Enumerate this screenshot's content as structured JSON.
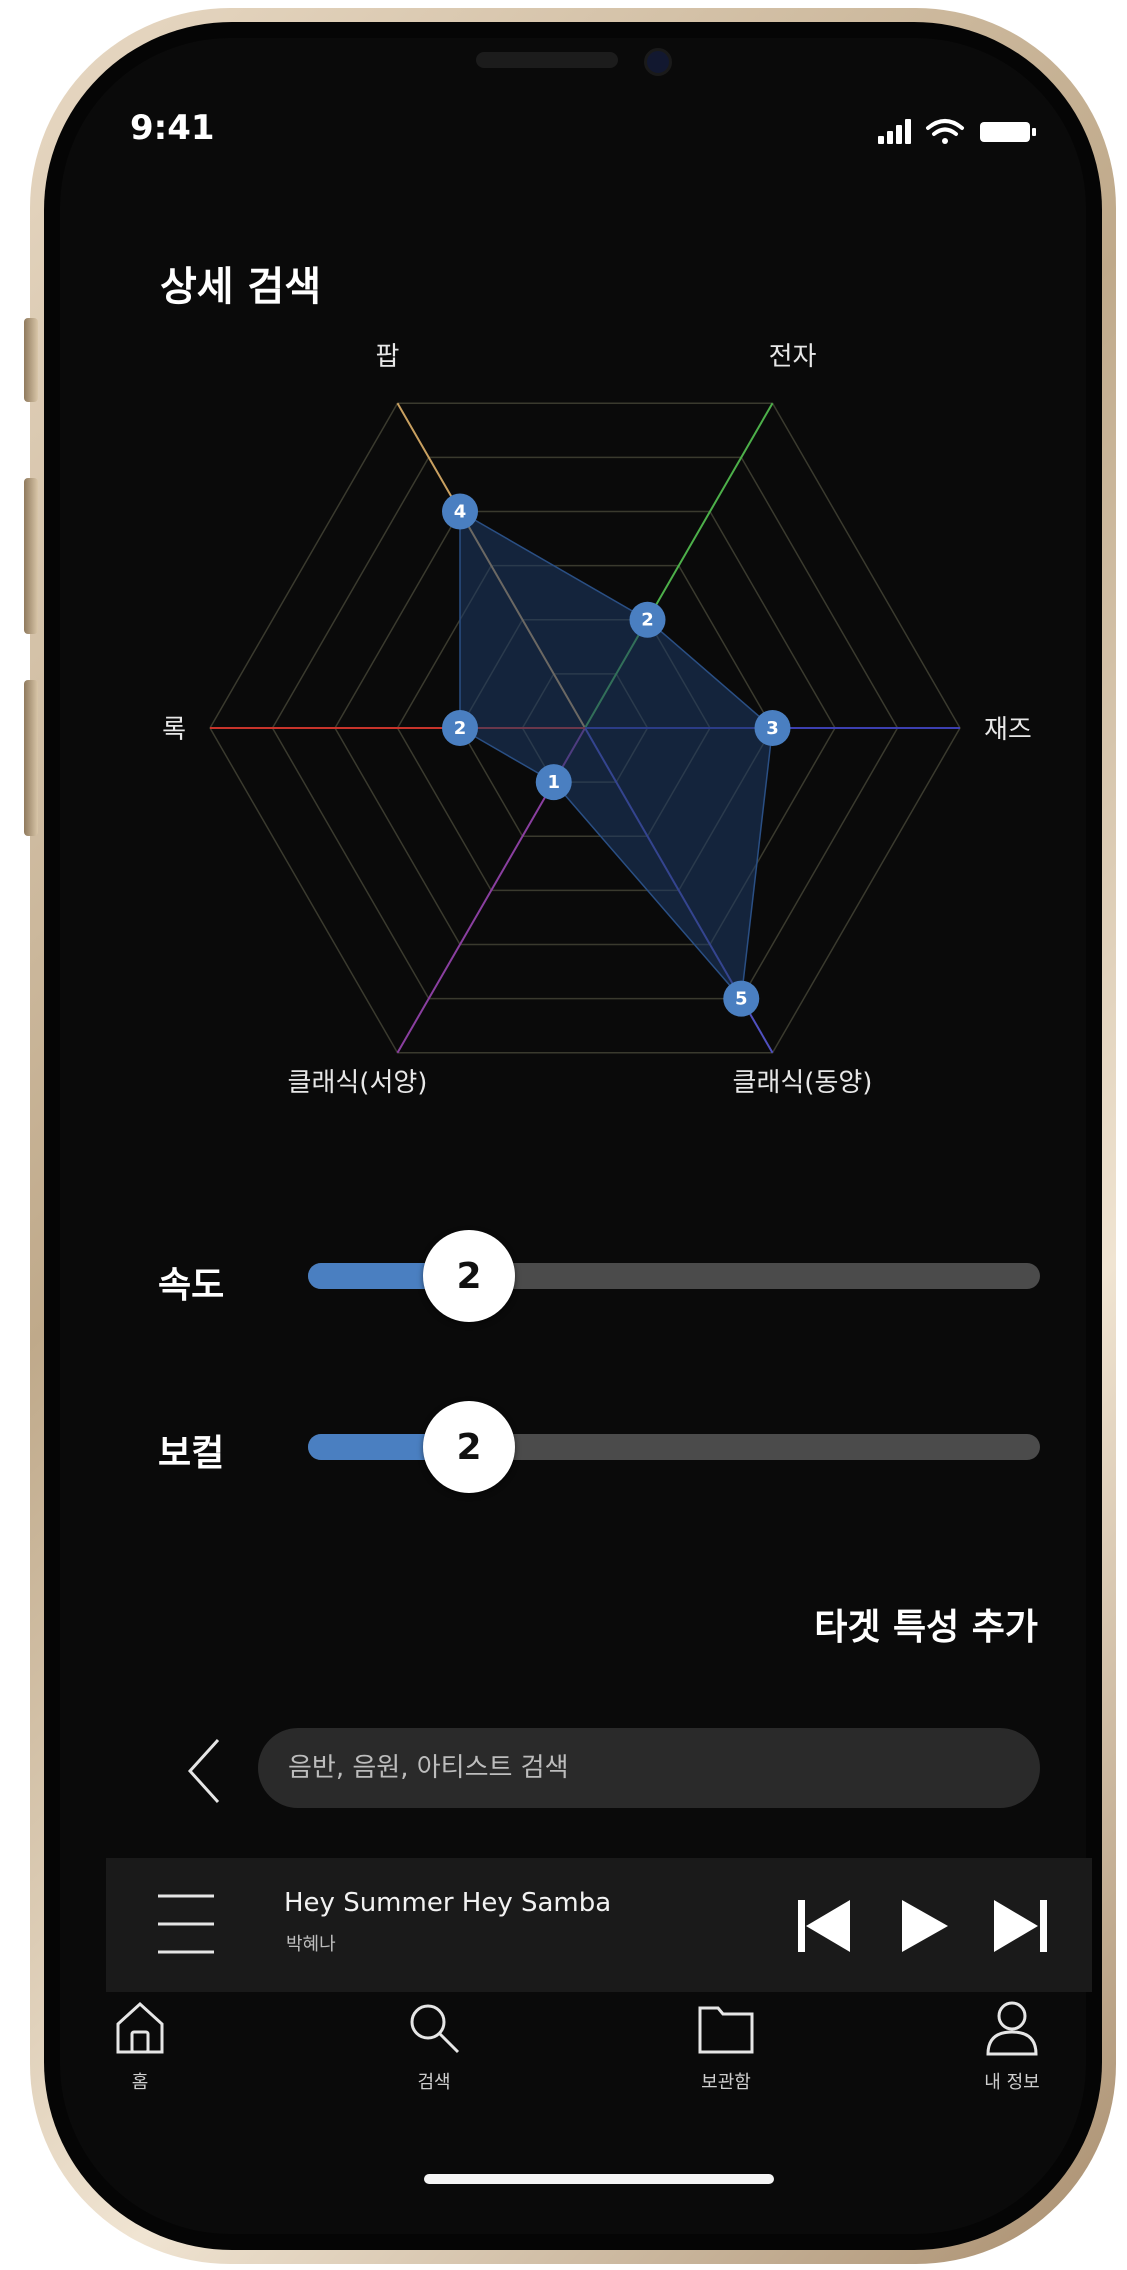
{
  "status_bar": {
    "time": "9:41"
  },
  "page": {
    "title": "상세 검색"
  },
  "chart_data": {
    "type": "radar",
    "title": "",
    "axes": [
      "팝",
      "전자",
      "재즈",
      "클래식(동양)",
      "클래식(서양)",
      "록"
    ],
    "axis_colors": [
      "#c9a060",
      "#4db04a",
      "#3c3fb0",
      "#5050c0",
      "#8a3fa0",
      "#c8342b"
    ],
    "max": 6,
    "values": [
      4,
      2,
      3,
      5,
      1,
      2
    ],
    "value_labels": [
      "4",
      "2",
      "3",
      "5",
      "1",
      "2"
    ],
    "fill_color": "#1d3a66",
    "point_color": "#4a7fc1"
  },
  "sliders": [
    {
      "label": "속도",
      "value": "2",
      "fraction": 0.22
    },
    {
      "label": "보컬",
      "value": "2",
      "fraction": 0.22
    }
  ],
  "add_target_label": "타겟 특성 추가",
  "search": {
    "placeholder": "음반, 음원, 아티스트 검색"
  },
  "player": {
    "song_title": "Hey Summer Hey Samba",
    "artist": "박혜나"
  },
  "tabs": [
    {
      "label": "홈",
      "icon": "home-icon"
    },
    {
      "label": "검색",
      "icon": "search-icon"
    },
    {
      "label": "보관함",
      "icon": "folder-icon"
    },
    {
      "label": "내 정보",
      "icon": "user-icon"
    }
  ],
  "colors": {
    "accent": "#4a7fc1",
    "background": "#0a0a0a"
  }
}
